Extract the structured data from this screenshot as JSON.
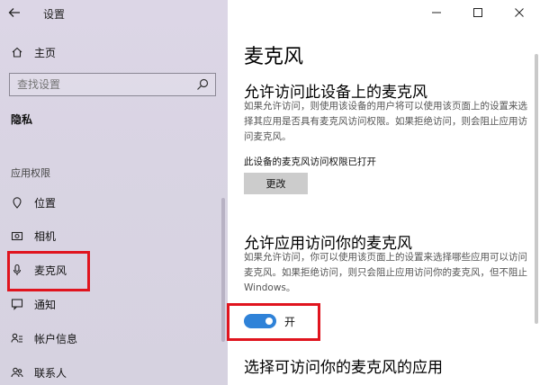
{
  "window": {
    "title": "设置"
  },
  "sidebar": {
    "home": "主页",
    "search_placeholder": "查找设置",
    "section": "隐私",
    "group": "应用权限",
    "items": [
      {
        "label": "位置",
        "icon": "location-icon"
      },
      {
        "label": "相机",
        "icon": "camera-icon"
      },
      {
        "label": "麦克风",
        "icon": "microphone-icon"
      },
      {
        "label": "通知",
        "icon": "notification-icon"
      },
      {
        "label": "帐户信息",
        "icon": "account-info-icon"
      },
      {
        "label": "联系人",
        "icon": "contacts-icon"
      }
    ]
  },
  "main": {
    "title": "麦克风",
    "section1": {
      "heading": "允许访问此设备上的麦克风",
      "desc": "如果允许访问，则使用该设备的用户将可以使用该页面上的设置来选择其应用是否具有麦克风访问权限。如果拒绝访问，则会阻止应用访问麦克风。",
      "status": "此设备的麦克风访问权限已打开",
      "button": "更改"
    },
    "section2": {
      "heading": "允许应用访问你的麦克风",
      "desc": "如果允许访问，你可以使用该页面上的设置来选择哪些应用可以访问麦克风。如果拒绝访问，则只会阻止应用访问你的麦克风，但不阻止 Windows。",
      "toggle_label": "开",
      "toggle_on": true
    },
    "section3": {
      "heading": "选择可访问你的麦克风的应用"
    }
  },
  "colors": {
    "accent": "#2f82d8",
    "highlight": "#e0141e",
    "sidebar_bg": "#dcd6e6"
  }
}
